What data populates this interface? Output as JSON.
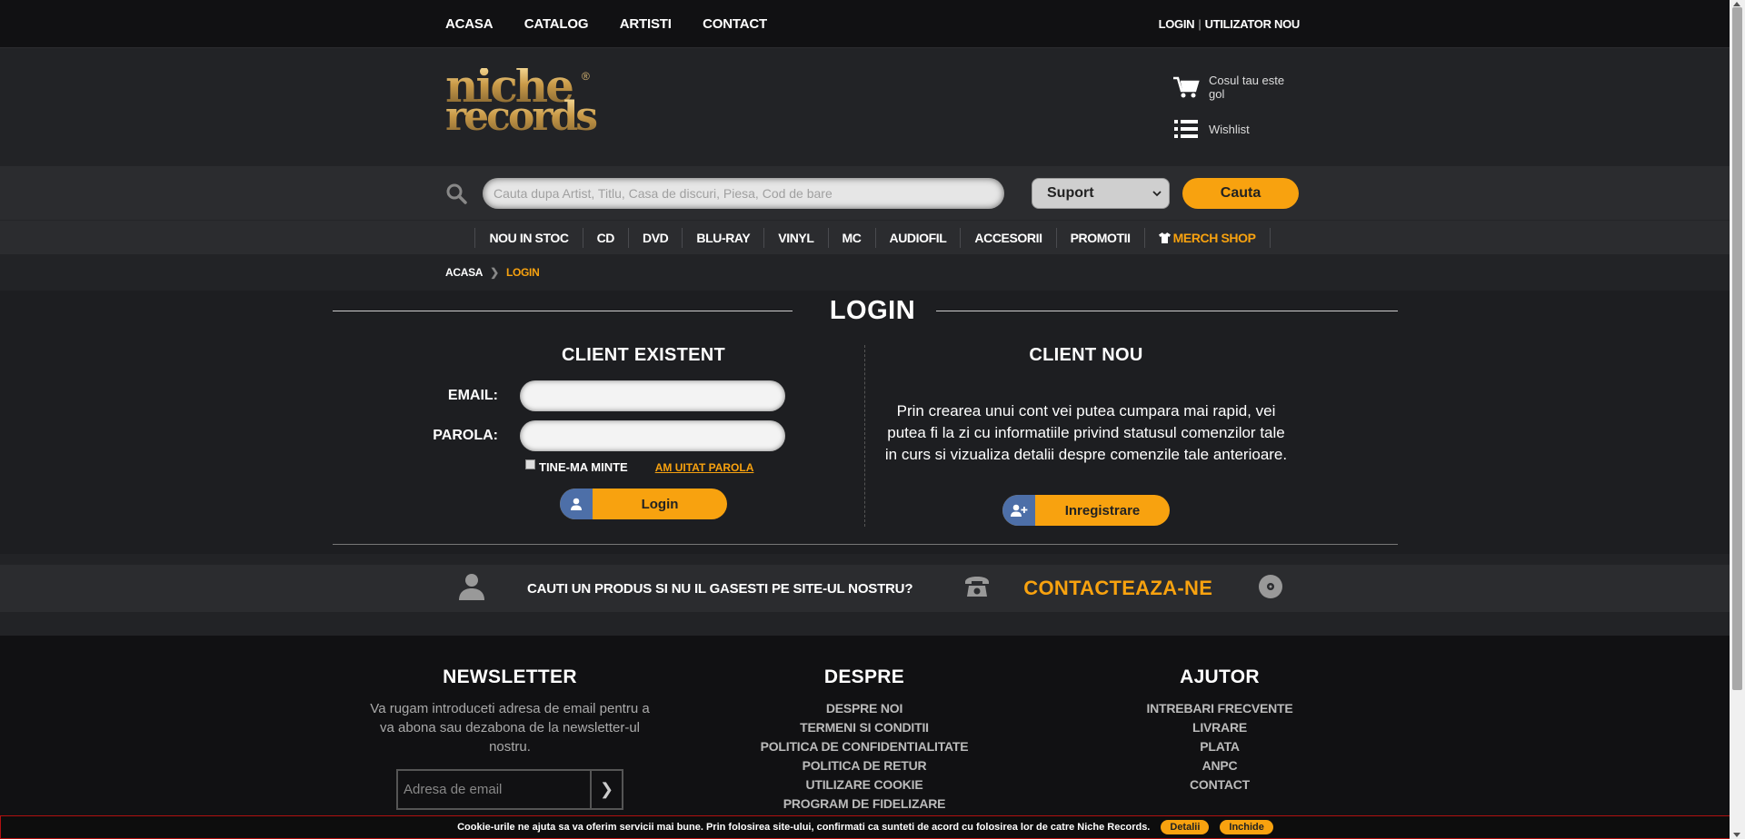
{
  "topbar": {
    "nav": [
      "ACASA",
      "CATALOG",
      "ARTISTI",
      "CONTACT"
    ],
    "login": "LOGIN",
    "register": "UTILIZATOR NOU"
  },
  "header": {
    "logo_top": "niche",
    "logo_bottom": "records",
    "logo_mark": "®",
    "cart_text": "Cosul tau este gol",
    "wishlist_text": "Wishlist"
  },
  "search": {
    "placeholder": "Cauta dupa Artist, Titlu, Casa de discuri, Piesa, Cod de bare",
    "select_value": "Suport",
    "button": "Cauta"
  },
  "categories": [
    "NOU IN STOC",
    "CD",
    "DVD",
    "BLU-RAY",
    "VINYL",
    "MC",
    "AUDIOFIL",
    "ACCESORII",
    "PROMOTII",
    "MERCH SHOP"
  ],
  "breadcrumb": {
    "home": "ACASA",
    "current": "LOGIN"
  },
  "login": {
    "title": "LOGIN",
    "existing_title": "CLIENT EXISTENT",
    "email_label": "EMAIL:",
    "password_label": "PAROLA:",
    "remember_label": "TINE-MA MINTE",
    "forgot_label": "AM UITAT PAROLA",
    "login_button": "Login",
    "new_title": "CLIENT NOU",
    "new_text": "Prin crearea unui cont vei putea cumpara mai rapid, vei putea fi la zi cu informatiile privind statusul comenzilor tale in curs si vizualiza detalii despre comenzile tale anterioare.",
    "register_button": "Inregistrare"
  },
  "contact_strip": {
    "question": "CAUTI UN PRODUS SI NU IL GASESTI PE SITE-UL NOSTRU?",
    "cta": "CONTACTEAZA-NE"
  },
  "footer": {
    "newsletter_title": "NEWSLETTER",
    "newsletter_text": "Va rugam introduceti adresa de email pentru a va abona sau dezabona de la newsletter-ul nostru.",
    "newsletter_placeholder": "Adresa de email",
    "about_title": "DESPRE",
    "about_links": [
      "DESPRE NOI",
      "TERMENI SI CONDITII",
      "POLITICA DE CONFIDENTIALITATE",
      "POLITICA DE RETUR",
      "UTILIZARE COOKIE",
      "PROGRAM DE FIDELIZARE"
    ],
    "help_title": "AJUTOR",
    "help_links": [
      "INTREBARI FRECVENTE",
      "LIVRARE",
      "PLATA",
      "ANPC",
      "CONTACT"
    ]
  },
  "cookie": {
    "text": "Cookie-urile ne ajuta sa va oferim servicii mai bune. Prin folosirea site-ului, confirmati ca sunteti de acord cu folosirea lor de catre Niche Records.",
    "details": "Detalii",
    "close": "Inchide"
  },
  "colors": {
    "accent": "#f8a20f",
    "icon_blue": "#4d6fa8",
    "background": "#222326"
  }
}
